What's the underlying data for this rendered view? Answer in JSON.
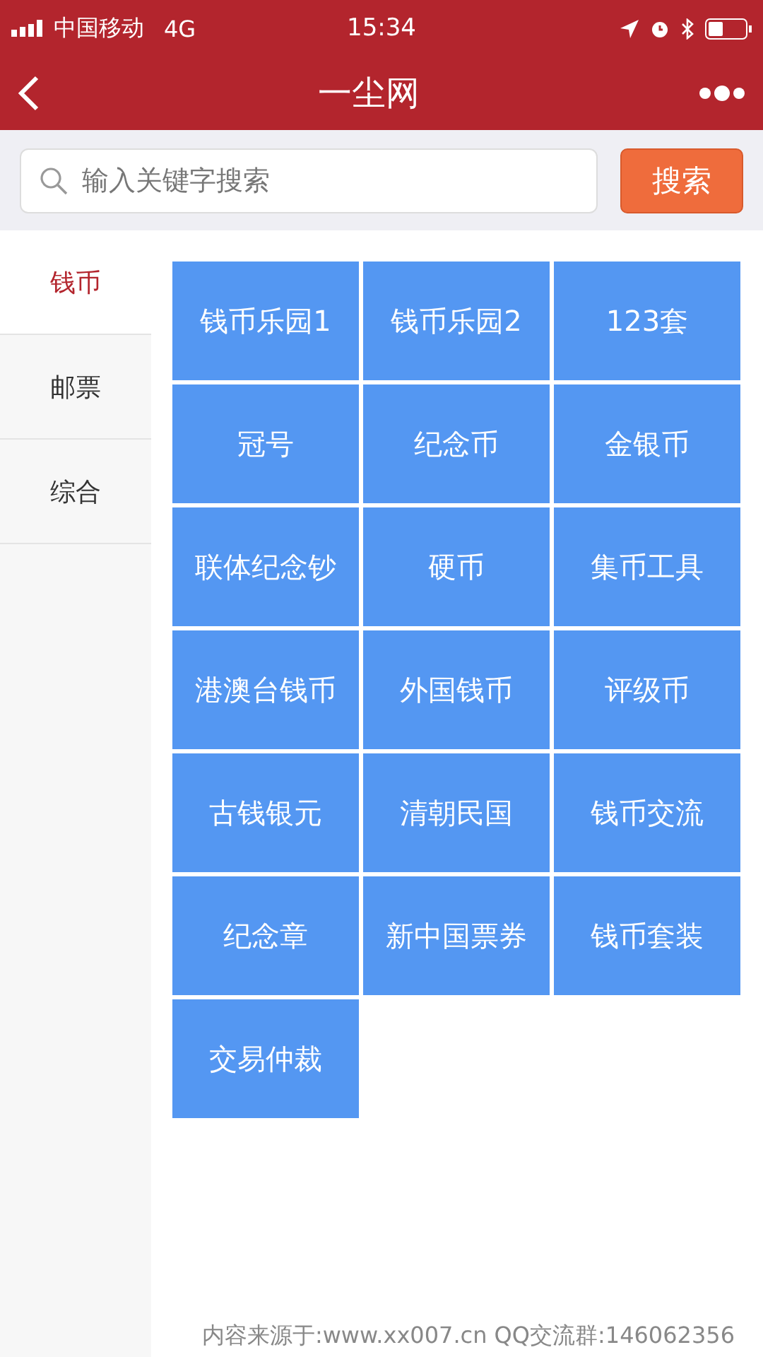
{
  "status_bar": {
    "carrier": "中国移动",
    "network": "4G",
    "time": "15:34"
  },
  "nav": {
    "title": "一尘网"
  },
  "search": {
    "placeholder": "输入关键字搜索",
    "button": "搜索"
  },
  "sidebar": {
    "items": [
      {
        "label": "钱币",
        "selected": true
      },
      {
        "label": "邮票",
        "selected": false
      },
      {
        "label": "综合",
        "selected": false
      }
    ]
  },
  "categories": [
    "钱币乐园1",
    "钱币乐园2",
    "123套",
    "冠号",
    "纪念币",
    "金银币",
    "联体纪念钞",
    "硬币",
    "集币工具",
    "港澳台钱币",
    "外国钱币",
    "评级币",
    "古钱银元",
    "清朝民国",
    "钱币交流",
    "纪念章",
    "新中国票券",
    "钱币套装",
    "交易仲裁"
  ],
  "footer": "内容来源于:www.xx007.cn QQ交流群:146062356"
}
